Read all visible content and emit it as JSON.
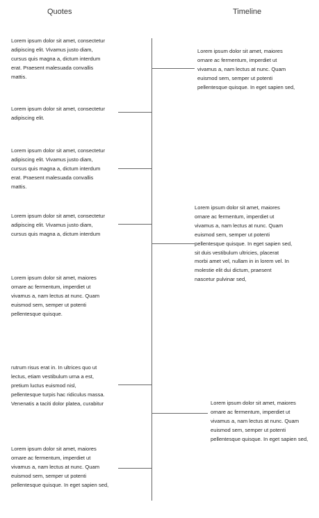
{
  "headers": {
    "quotes": "Quotes",
    "timeline": "Timeline"
  },
  "left_quotes": [
    "Lorem ipsum dolor sit amet, consectetur\nadipiscing elit. Vivamus justo diam,\ncursus quis magna a, dictum interdum\nerat. Praesent malesuada convallis\nmattis.",
    "Lorem ipsum dolor sit amet, consectetur\nadipiscing elit.",
    "Lorem ipsum dolor sit amet, consectetur\nadipiscing elit. Vivamus justo diam,\ncursus quis magna a, dictum interdum\nerat. Praesent malesuada convallis\nmattis.",
    "Lorem ipsum dolor sit amet, consectetur\nadipiscing elit. Vivamus justo diam,\ncursus quis magna a, dictum interdum",
    "Lorem ipsum dolor sit amet, maiores\nornare ac fermentum, imperdiet ut\nvivamus a, nam lectus at nunc. Quam\neuismod sem, semper ut potenti\npellentesque quisque.",
    " rutrum risus erat in.  In ultrices quo ut\nlectus, etiam vestibulum urna a est,\npretium luctus euismod nisl,\npellentesque turpis hac ridiculus massa.\nVenenatis a taciti dolor platea, curabitur",
    "Lorem ipsum dolor sit amet, maiores\nornare ac fermentum, imperdiet ut\nvivamus a, nam lectus at nunc. Quam\neuismod sem, semper ut potenti\npellentesque quisque. In eget sapien sed,"
  ],
  "right_quotes": [
    "Lorem ipsum dolor sit amet, maiores\nornare ac fermentum, imperdiet ut\nvivamus a, nam lectus at nunc. Quam\neuismod sem, semper ut potenti\npellentesque quisque. In eget sapien sed,",
    "Lorem ipsum dolor sit amet, maiores\nornare ac fermentum, imperdiet ut\nvivamus a, nam lectus at nunc. Quam\neuismod sem, semper ut potenti\npellentesque quisque. In eget sapien sed,\nsit duis vestibulum ultricies, placerat\nmorbi amet vel, nullam in in lorem vel. In\nmolestie elit dui dictum, praesent\nnascetur pulvinar sed,",
    "Lorem ipsum dolor sit amet, maiores\nornare ac fermentum, imperdiet ut\nvivamus a, nam lectus at nunc. Quam\neuismod sem, semper ut potenti\npellentesque quisque. In eget sapien sed,"
  ]
}
